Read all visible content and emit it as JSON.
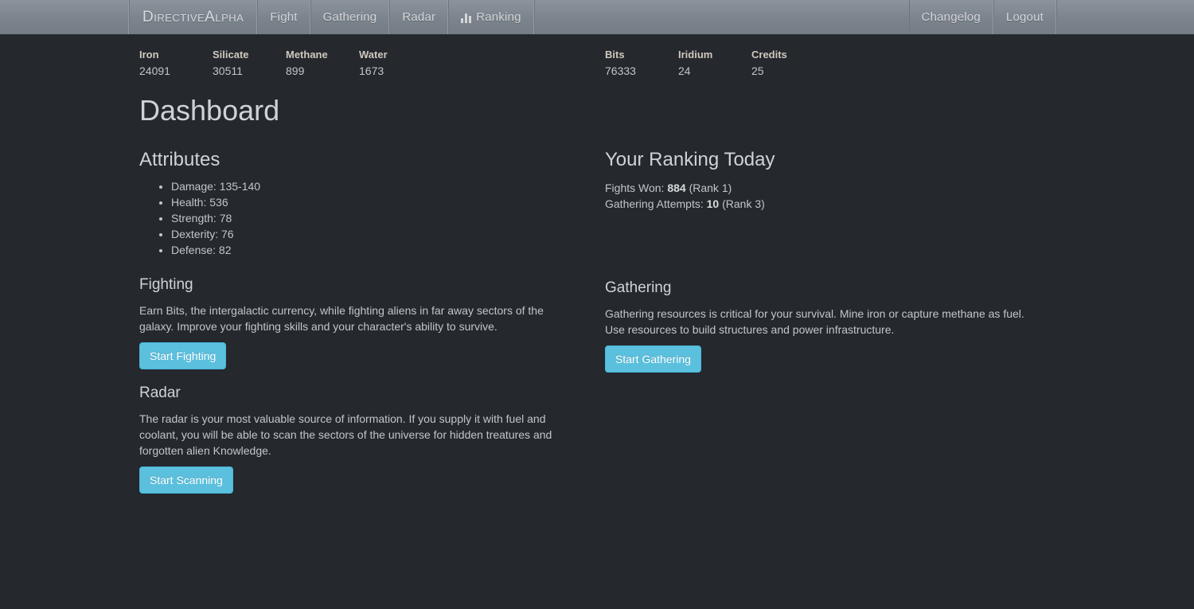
{
  "navbar": {
    "brand": "DirectiveAlpha",
    "items": [
      {
        "label": "Fight",
        "icon": null
      },
      {
        "label": "Gathering",
        "icon": null
      },
      {
        "label": "Radar",
        "icon": null
      },
      {
        "label": "Ranking",
        "icon": "bar-chart-icon"
      }
    ],
    "right_items": [
      {
        "label": "Changelog"
      },
      {
        "label": "Logout"
      }
    ]
  },
  "resources": {
    "primary": [
      {
        "label": "Iron",
        "value": "24091"
      },
      {
        "label": "Silicate",
        "value": "30511"
      },
      {
        "label": "Methane",
        "value": "899"
      },
      {
        "label": "Water",
        "value": "1673"
      }
    ],
    "secondary": [
      {
        "label": "Bits",
        "value": "76333"
      },
      {
        "label": "Iridium",
        "value": "24"
      },
      {
        "label": "Credits",
        "value": "25"
      }
    ]
  },
  "page": {
    "title": "Dashboard"
  },
  "attributes": {
    "title": "Attributes",
    "items": [
      "Damage: 135-140",
      "Health: 536",
      "Strength: 78",
      "Dexterity: 76",
      "Defense: 82"
    ]
  },
  "ranking": {
    "title": "Your Ranking Today",
    "fights_label": "Fights Won:",
    "fights_value": "884",
    "fights_rank": "(Rank 1)",
    "gathering_label": "Gathering Attempts:",
    "gathering_value": "10",
    "gathering_rank": "(Rank 3)"
  },
  "fighting": {
    "title": "Fighting",
    "text": "Earn Bits, the intergalactic currency, while fighting aliens in far away sectors of the galaxy. Improve your fighting skills and your character's ability to survive.",
    "button": "Start Fighting"
  },
  "radar": {
    "title": "Radar",
    "text": "The radar is your most valuable source of information. If you supply it with fuel and coolant, you will be able to scan the sectors of the universe for hidden treatures and forgotten alien Knowledge.",
    "button": "Start Scanning"
  },
  "gathering": {
    "title": "Gathering",
    "text": "Gathering resources is critical for your survival. Mine iron or capture methane as fuel. Use resources to build structures and power infrastructure.",
    "button": "Start Gathering"
  },
  "colors": {
    "background": "#25282d",
    "navbar_top": "#8b939b",
    "navbar_bottom": "#747c85",
    "button_info": "#5bc0de",
    "text": "#c2c6ca",
    "heading": "#cfd3d7",
    "resource_label": "#cfc9be"
  }
}
